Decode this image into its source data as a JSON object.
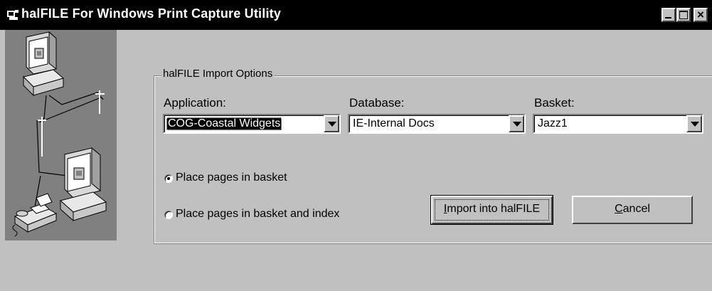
{
  "window": {
    "title": "halFILE For Windows Print Capture Utility"
  },
  "import_options": {
    "group_title": "halFILE Import Options",
    "application": {
      "label": "Application:",
      "value": "COG-Coastal Widgets"
    },
    "database": {
      "label": "Database:",
      "value": "IE-Internal Docs"
    },
    "basket": {
      "label": "Basket:",
      "value": "Jazz1"
    },
    "radio_basket": {
      "label": "Place pages in basket",
      "selected": true
    },
    "radio_basket_index": {
      "label": "Place pages in basket and index",
      "selected": false
    }
  },
  "buttons": {
    "import_mnemonic": "I",
    "import_rest": "mport into halFILE",
    "cancel_mnemonic": "C",
    "cancel_rest": "ancel"
  }
}
